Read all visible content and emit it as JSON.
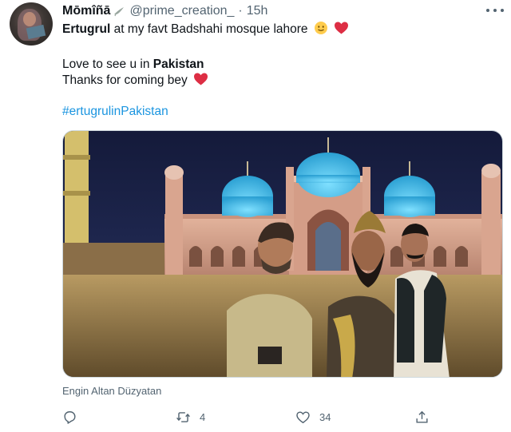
{
  "tweet": {
    "author_name": "Mōmîñā",
    "handle": "@prime_creation_",
    "separator": "·",
    "time": "15h",
    "line1_bold": "Ertugrul",
    "line1_rest": " at my favt Badshahi mosque lahore",
    "line2_prefix": "Love to see u in ",
    "line2_bold": "Pakistan",
    "line3": "Thanks for coming bey",
    "hashtag": "#ertugrulinPakistan",
    "media_caption": "Engin Altan Düzyatan"
  },
  "actions": {
    "reply_icon": "reply-icon",
    "retweet_icon": "retweet-icon",
    "retweet_count": "4",
    "like_icon": "heart-icon",
    "like_count": "34",
    "share_icon": "share-icon"
  },
  "colors": {
    "text": "#0f1419",
    "secondary": "#536471",
    "link": "#1b95e0",
    "heart": "#e0245e",
    "dome": "#3fb6e6"
  }
}
